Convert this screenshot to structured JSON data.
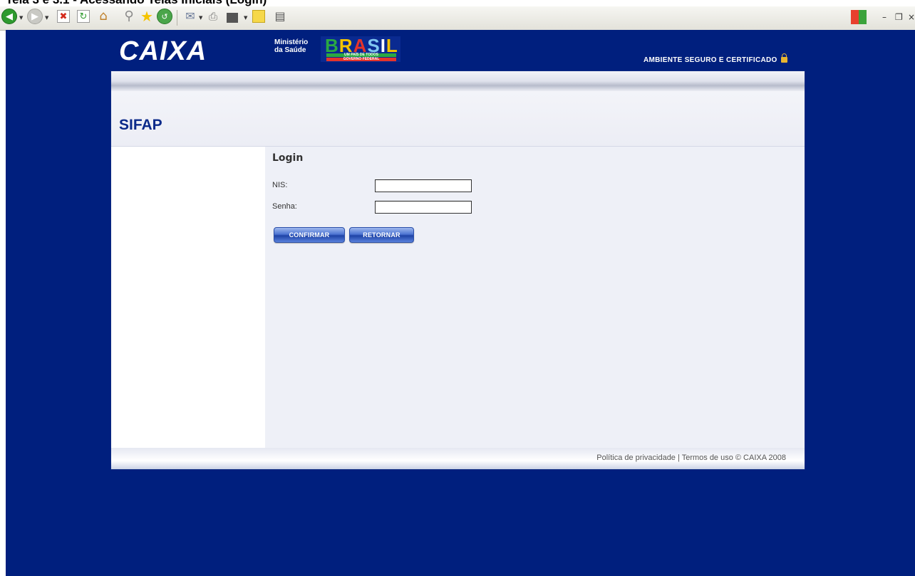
{
  "doc_caption": "Tela 3 e 3.1 - Acessando Telas Iniciais (Login)",
  "browser_toolbar": {
    "icons": [
      "back-icon",
      "forward-icon",
      "stop-icon",
      "refresh-icon",
      "home-icon",
      "search-icon",
      "favorites-icon",
      "history-icon",
      "mail-icon",
      "print-icon",
      "edit-icon",
      "notes-icon",
      "research-icon",
      "windows-logo-icon"
    ],
    "colors": {
      "back": "#2e9a2e",
      "stop": "#d42a1c",
      "favorites": "#f5c400"
    }
  },
  "header": {
    "logo_text": "CAIXA",
    "ministerio_line1": "Ministério",
    "ministerio_line2": "da Saúde",
    "brasil_letters": [
      "B",
      "R",
      "A",
      "S",
      "I",
      "L"
    ],
    "brasil_tagline": "UM PAÍS DE TODOS",
    "brasil_govt": "GOVERNO FEDERAL",
    "secure_text": "AMBIENTE SEGURO E CERTIFICADO"
  },
  "page": {
    "title": "SIFAP",
    "login_heading": "Login",
    "nis_label": "NIS:",
    "nis_value": "",
    "senha_label": "Senha:",
    "senha_value": "",
    "confirm_label": "CONFIRMAR",
    "return_label": "RETORNAR"
  },
  "footer": {
    "text": "Política de privacidade | Termos de uso © CAIXA 2008"
  },
  "colors": {
    "background_blue": "#001f7e",
    "title_blue": "#0b2a8a",
    "content_bg": "#eef0f7"
  }
}
